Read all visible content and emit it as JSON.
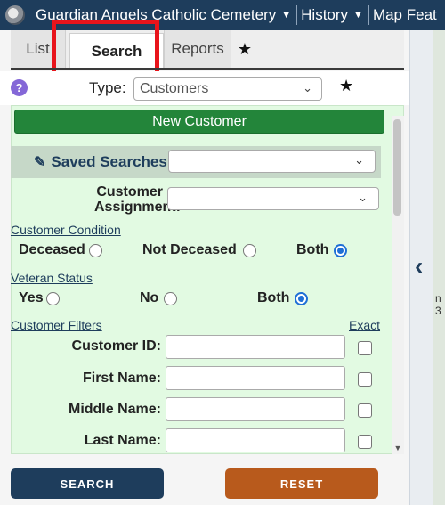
{
  "topbar": {
    "app_name": "Guardian Angels Catholic Cemetery",
    "history": "History",
    "map_features": "Map Feat"
  },
  "tabs": {
    "list": "List",
    "search": "Search",
    "reports": "Reports",
    "star": "★"
  },
  "type_row": {
    "help": "?",
    "label": "Type:",
    "value": "Customers",
    "star": "★"
  },
  "panel": {
    "new_customer": "New Customer",
    "saved_searches": "Saved Searches:",
    "customer_assignment_1": "Customer",
    "customer_assignment_2": "Assignment:",
    "customer_condition": {
      "title": "Customer Condition",
      "options": [
        "Deceased",
        "Not Deceased",
        "Both"
      ],
      "selected": "Both"
    },
    "veteran_status": {
      "title": "Veteran Status",
      "options": [
        "Yes",
        "No",
        "Both"
      ],
      "selected": "Both"
    },
    "customer_filters": "Customer Filters",
    "exact": "Exact",
    "fields": [
      "Customer ID:",
      "First Name:",
      "Middle Name:",
      "Last Name:"
    ]
  },
  "buttons": {
    "search": "SEARCH",
    "reset": "RESET"
  },
  "map_edge": {
    "fragment_1": "n",
    "fragment_2": "3"
  },
  "colors": {
    "nav": "#1e3d5c",
    "new_customer": "#23853a",
    "panel": "#e2fae2",
    "reset": "#b85a1c",
    "highlight": "#e8141b",
    "radio_selected": "#1f6fd6"
  }
}
